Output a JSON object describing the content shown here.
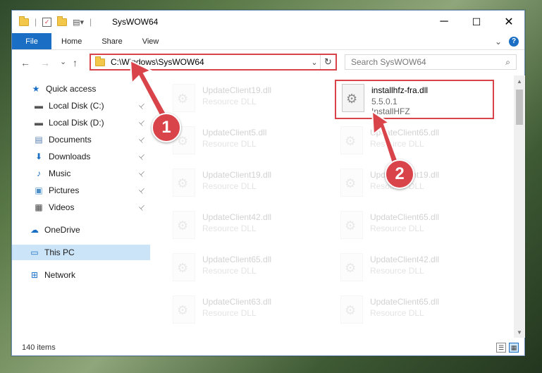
{
  "window": {
    "title": "SysWOW64",
    "minimize": "─",
    "maximize": "☐",
    "close": "✕"
  },
  "ribbon": {
    "tabs": [
      "File",
      "Home",
      "Share",
      "View"
    ],
    "expand": "⌄",
    "help": "?"
  },
  "nav": {
    "back": "←",
    "forward": "→",
    "recent": "⌄",
    "up": "↑",
    "address": "C:\\Windows\\SysWOW64",
    "address_dropdown": "⌄",
    "refresh": "↻",
    "search_placeholder": "Search SysWOW64",
    "search_icon": "⌕"
  },
  "sidebar": {
    "items": [
      {
        "label": "Quick access",
        "icon": "star-icon",
        "glyph": "★",
        "color": "#1a6fc4",
        "pinned": false
      },
      {
        "label": "Local Disk (C:)",
        "icon": "drive-icon",
        "glyph": "▬",
        "color": "#555555",
        "pinned": true
      },
      {
        "label": "Local Disk (D:)",
        "icon": "drive-icon",
        "glyph": "▬",
        "color": "#555555",
        "pinned": true
      },
      {
        "label": "Documents",
        "icon": "documents-icon",
        "glyph": "▤",
        "color": "#5a7fb0",
        "pinned": true
      },
      {
        "label": "Downloads",
        "icon": "download-icon",
        "glyph": "⬇",
        "color": "#1a6fc4",
        "pinned": true
      },
      {
        "label": "Music",
        "icon": "music-icon",
        "glyph": "♪",
        "color": "#1a6fc4",
        "pinned": true
      },
      {
        "label": "Pictures",
        "icon": "pictures-icon",
        "glyph": "▣",
        "color": "#4c8fc9",
        "pinned": true
      },
      {
        "label": "Videos",
        "icon": "videos-icon",
        "glyph": "▦",
        "color": "#444444",
        "pinned": true
      },
      {
        "label": "OneDrive",
        "icon": "cloud-icon",
        "glyph": "☁",
        "color": "#1a6fc4",
        "pinned": false
      },
      {
        "label": "This PC",
        "icon": "computer-icon",
        "glyph": "▭",
        "color": "#1a6fc4",
        "pinned": false
      },
      {
        "label": "Network",
        "icon": "network-icon",
        "glyph": "⊞",
        "color": "#1a6fc4",
        "pinned": false
      }
    ],
    "pin_glyph": "📌"
  },
  "files": {
    "left_column": [
      {
        "name": "UpdateClient19.dll",
        "type": "Resource DLL"
      },
      {
        "name": "UpdateClient5.dll",
        "type": "Resource DLL"
      },
      {
        "name": "UpdateClient19.dll",
        "type": "Resource DLL"
      },
      {
        "name": "UpdateClient42.dll",
        "type": "Resource DLL"
      },
      {
        "name": "UpdateClient65.dll",
        "type": "Resource DLL"
      },
      {
        "name": "UpdateClient63.dll",
        "type": "Resource DLL"
      },
      {
        "name": "UpdateClient63.dll",
        "type": "Resource DLL"
      }
    ],
    "highlighted": {
      "name": "installhfz-fra.dll",
      "version": "5.5.0.1",
      "company": "InstallHFZ"
    },
    "right_column": [
      {
        "name": "UpdateClient65.dll",
        "type": "Resource DLL"
      },
      {
        "name": "UpdateClient19.dll",
        "type": "Resource DLL"
      },
      {
        "name": "UpdateClient65.dll",
        "type": "Resource DLL"
      },
      {
        "name": "UpdateClient42.dll",
        "type": "Resource DLL"
      },
      {
        "name": "UpdateClient65.dll",
        "type": "Resource DLL"
      },
      {
        "name": "UpdateClient65.dll",
        "type": "Resource DLL"
      }
    ]
  },
  "status": {
    "items": "140 items",
    "details_view": "☰",
    "tiles_view": "▦"
  },
  "annotations": {
    "step1": "1",
    "step2": "2",
    "color": "#d9434a"
  }
}
